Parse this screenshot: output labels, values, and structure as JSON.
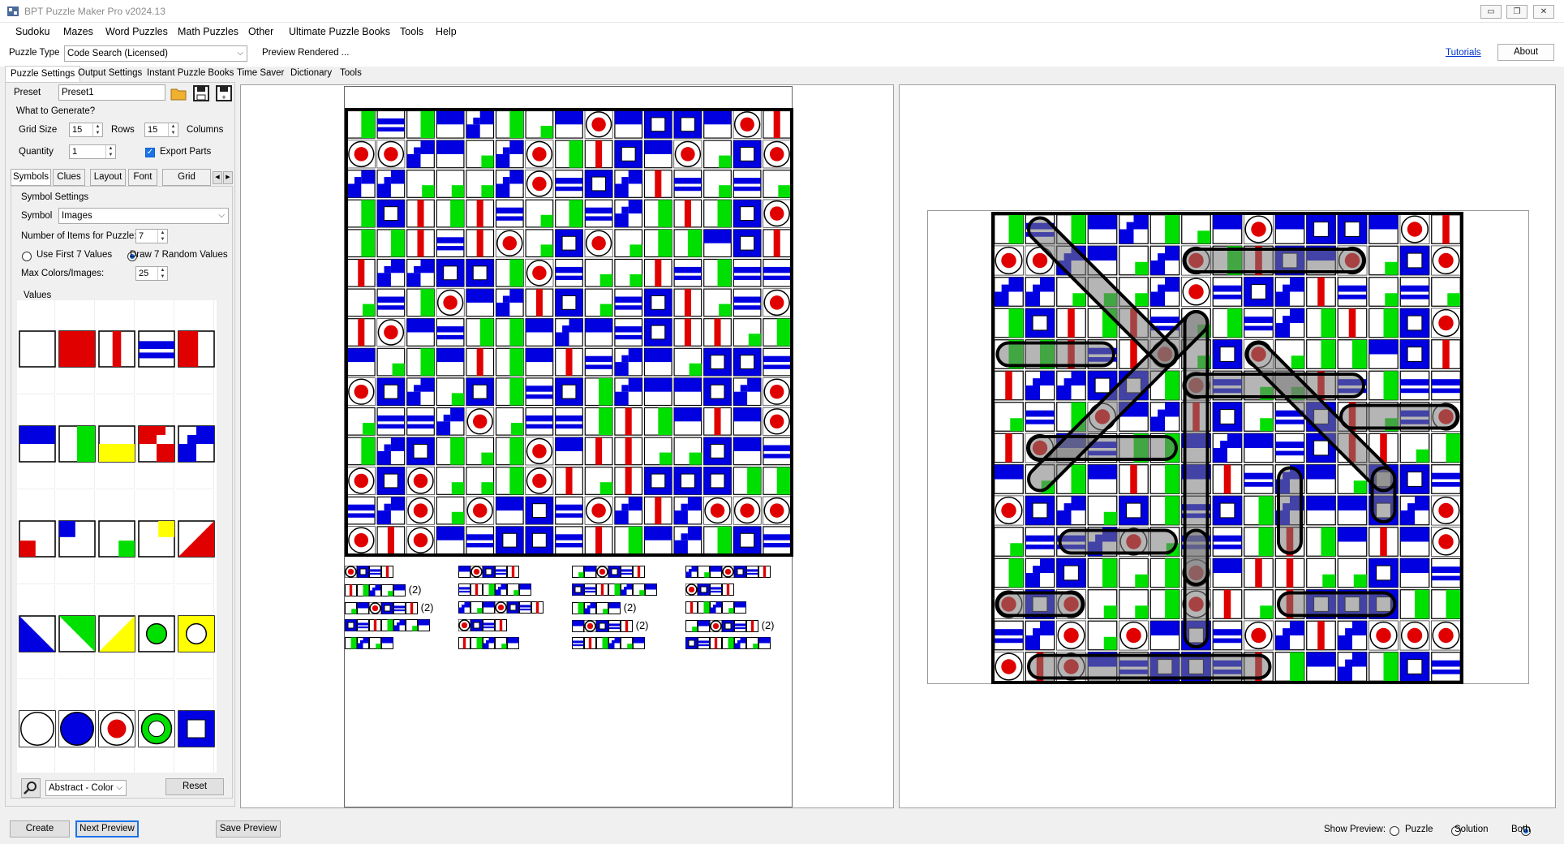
{
  "window": {
    "title": "BPT Puzzle Maker Pro v2024.13"
  },
  "menu": [
    "Sudoku",
    "Mazes",
    "Word Puzzles",
    "Math Puzzles",
    "Other",
    "Ultimate Puzzle Books",
    "Tools",
    "Help"
  ],
  "puzzle_type": {
    "label": "Puzzle Type",
    "value": "Code Search (Licensed)",
    "status": "Preview Rendered ...",
    "tutorials": "Tutorials",
    "about": "About"
  },
  "left_tabs": [
    "Puzzle Settings",
    "Output Settings",
    "Instant Puzzle Books",
    "Time Saver",
    "Dictionary",
    "Tools"
  ],
  "preset": {
    "label": "Preset",
    "value": "Preset1"
  },
  "generate": {
    "heading": "What to Generate?",
    "grid_size_label": "Grid Size",
    "rows_value": "15",
    "rows_label": "Rows",
    "cols_value": "15",
    "cols_label": "Columns",
    "quantity_label": "Quantity",
    "quantity_value": "1",
    "export_parts": "Export Parts"
  },
  "sub_tabs": [
    "Symbols",
    "Clues",
    "Layout",
    "Font",
    "Grid Styling"
  ],
  "symbol": {
    "heading": "Symbol Settings",
    "label": "Symbol",
    "value": "Images",
    "num_items_label": "Number of Items for Puzzle:",
    "num_items_value": "7",
    "use_first": "Use First 7 Values",
    "draw_random": "Draw 7 Random Values",
    "max_label": "Max Colors/Images:",
    "max_value": "25",
    "values_label": "Values",
    "theme": "Abstract - Color",
    "reset": "Reset"
  },
  "value_icons": [
    "empty",
    "red-fill",
    "red-stripe",
    "blue-band",
    "red-half",
    "blue-top",
    "green-stripe",
    "yellow-bottom",
    "checker-red",
    "checker-blue",
    "red-corner",
    "blue-corner",
    "green-corner",
    "yellow-corner",
    "red-triangle",
    "blue-triangle",
    "green-triangle",
    "yellow-triangle",
    "green-circle",
    "yellow-ring",
    "white-circle",
    "blue-circle",
    "red-dot",
    "green-ring",
    "blue-square"
  ],
  "clues": [
    [
      "(2)",
      "(2)",
      ""
    ],
    [
      "",
      "",
      ""
    ],
    [
      "",
      "(2)",
      "(2)"
    ],
    [
      "",
      "",
      "(2)"
    ]
  ],
  "footer": {
    "create": "Create",
    "next_preview": "Next Preview",
    "save_preview": "Save Preview",
    "show_preview": "Show Preview:",
    "puzzle": "Puzzle",
    "solution": "Solution",
    "both": "Both"
  },
  "colors": {
    "blue": "#0000e0",
    "red": "#e00000",
    "green": "#00e000",
    "yellow": "#ffff00"
  }
}
